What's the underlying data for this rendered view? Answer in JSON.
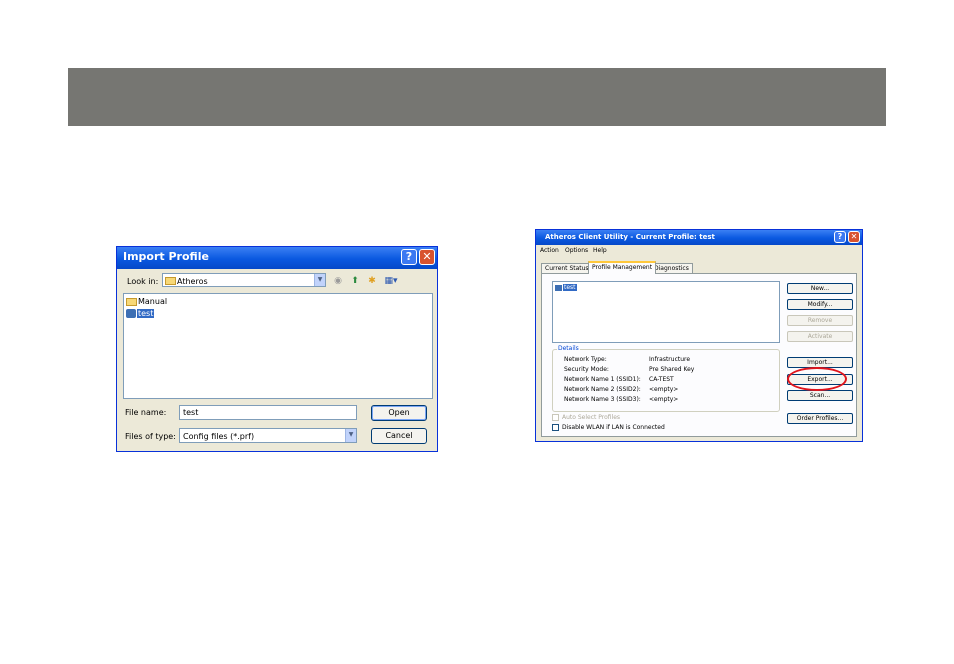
{
  "import_dialog": {
    "title": "Import Profile",
    "look_in_label": "Look in:",
    "look_in_value": "Atheros",
    "items": [
      {
        "name": "Manual",
        "icon": "folder-icon"
      },
      {
        "name": "test",
        "icon": "profile-icon",
        "selected": true
      }
    ],
    "file_name_label": "File name:",
    "file_name_value": "test",
    "file_type_label": "Files of type:",
    "file_type_value": "Config files (*.prf)",
    "open_label": "Open",
    "cancel_label": "Cancel"
  },
  "atheros": {
    "title": "Atheros Client Utility - Current Profile: test",
    "menu": [
      "Action",
      "Options",
      "Help"
    ],
    "tabs": [
      "Current Status",
      "Profile Management",
      "Diagnostics"
    ],
    "active_tab": "Profile Management",
    "profiles": [
      "test"
    ],
    "buttons": {
      "new": "New...",
      "modify": "Modify...",
      "remove": "Remove",
      "activate": "Activate",
      "import": "Import...",
      "export": "Export...",
      "scan": "Scan...",
      "order": "Order Profiles..."
    },
    "details": {
      "legend": "Details",
      "rows": [
        {
          "label": "Network Type:",
          "value": "Infrastructure"
        },
        {
          "label": "Security Mode:",
          "value": "Pre Shared Key"
        },
        {
          "label": "Network Name 1 (SSID1):",
          "value": "CA-TEST"
        },
        {
          "label": "Network Name 2 (SSID2):",
          "value": "<empty>"
        },
        {
          "label": "Network Name 3 (SSID3):",
          "value": "<empty>"
        }
      ]
    },
    "auto_select_label": "Auto Select Profiles",
    "disable_wlan_label": "Disable WLAN if LAN is Connected"
  },
  "colors": {
    "banner": "#767672",
    "highlight_circle": "#e0141c",
    "titlebar": "#0a58e0"
  }
}
